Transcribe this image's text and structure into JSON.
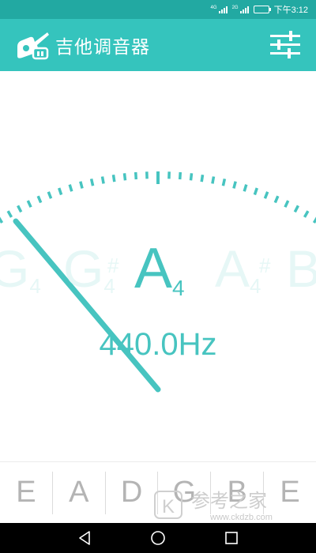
{
  "status_bar": {
    "network_1": "4G",
    "network_2": "2G",
    "time": "下午3:12"
  },
  "app": {
    "title": "吉他调音器",
    "brand_color": "#35c4bd",
    "accent_color": "#47c4c0"
  },
  "icons": {
    "app": "guitar-tuner-icon",
    "settings": "sliders-icon",
    "back": "back-triangle-icon",
    "home": "home-circle-icon",
    "recents": "recents-square-icon"
  },
  "tuner": {
    "notes": [
      {
        "letter": "G",
        "octave": "4",
        "sharp": "",
        "role": "far-left"
      },
      {
        "letter": "G",
        "octave": "4",
        "sharp": "#",
        "role": "left"
      },
      {
        "letter": "A",
        "octave": "4",
        "sharp": "",
        "role": "current"
      },
      {
        "letter": "A",
        "octave": "4",
        "sharp": "#",
        "role": "right"
      },
      {
        "letter": "B",
        "octave": "",
        "sharp": "",
        "role": "far-right"
      }
    ],
    "frequency": "440.0Hz"
  },
  "strings": [
    "E",
    "A",
    "D",
    "G",
    "B",
    "E"
  ],
  "watermark": {
    "text": "参考之家",
    "url": "www.ckdzb.com"
  }
}
